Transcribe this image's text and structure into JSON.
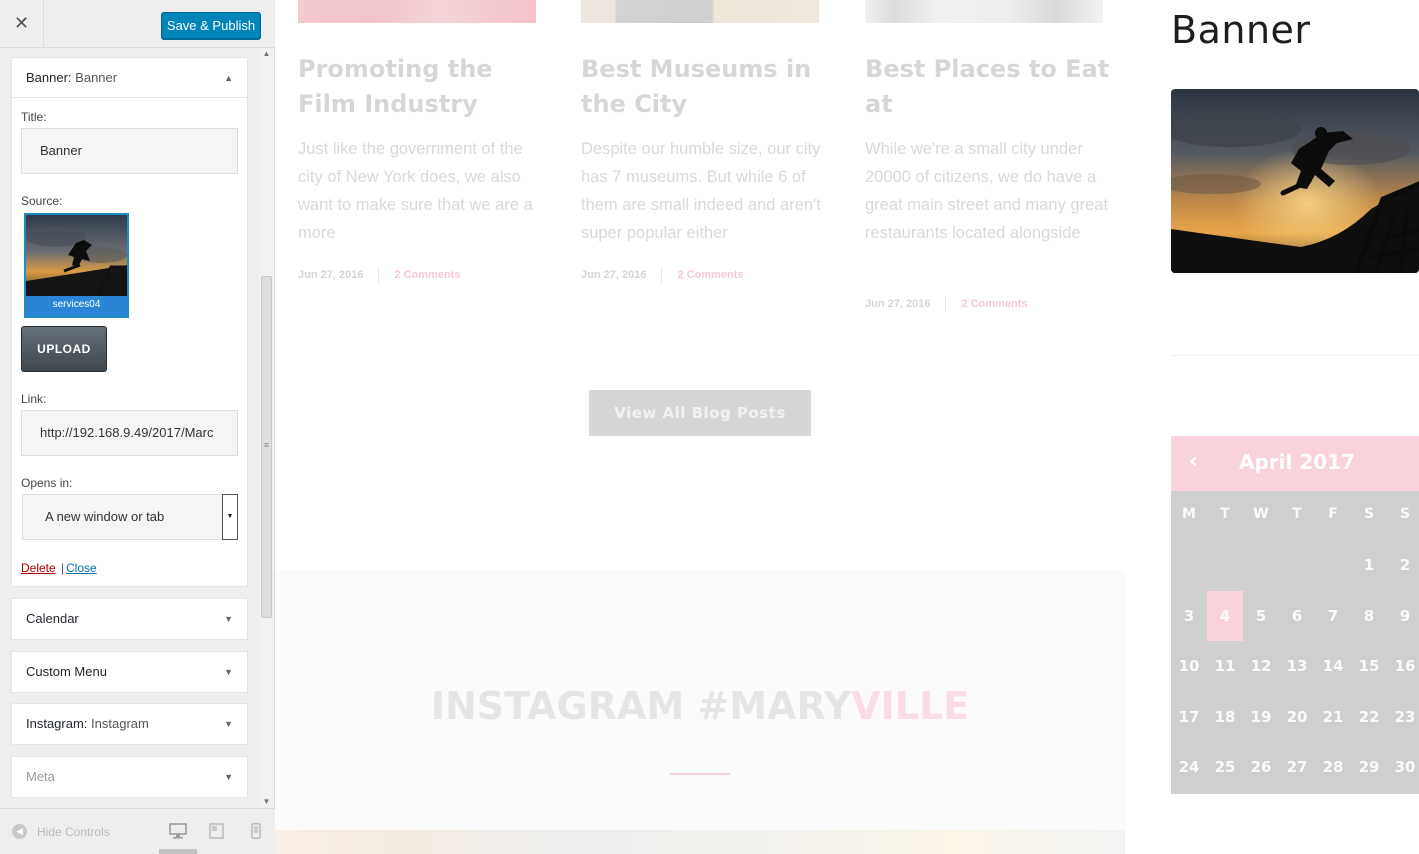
{
  "customizer": {
    "close_glyph": "✕",
    "save_label": "Save & Publish",
    "banner_widget": {
      "header_name": "Banner:",
      "header_sub": "Banner",
      "title_label": "Title:",
      "title_value": "Banner",
      "source_label": "Source:",
      "source_filename": "services04",
      "upload_label": "UPLOAD",
      "link_label": "Link:",
      "link_value": "http://192.168.9.49/2017/Marc",
      "opens_label": "Opens in:",
      "opens_value": "A new window or tab",
      "delete_label": "Delete",
      "separator": "|",
      "close_label": "Close"
    },
    "widgets": [
      {
        "name": "Calendar",
        "sub": ""
      },
      {
        "name": "Custom Menu",
        "sub": ""
      },
      {
        "name": "Instagram:",
        "sub": "Instagram"
      },
      {
        "name": "Meta",
        "sub": ""
      }
    ],
    "hide_controls_label": "Hide Controls",
    "arrow_up": "▲",
    "arrow_down": "▼"
  },
  "preview": {
    "posts": [
      {
        "title": "Promoting the Film Industry",
        "excerpt": "Just like the government of the city of New York does, we also want to make sure that we are a more",
        "date": "Jun 27, 2016",
        "comments": "2 Comments"
      },
      {
        "title": "Best Museums in the City",
        "excerpt": "Despite our humble size, our city has 7 museums. But while 6 of them are small indeed and aren't super popular either",
        "date": "Jun 27, 2016",
        "comments": "2 Comments"
      },
      {
        "title": "Best Places to Eat at",
        "excerpt": "While we're a small city under 20000 of citizens, we do have a great main street and many great restaurants located alongside",
        "date": "Jun 27, 2016",
        "comments": "2 Comments"
      }
    ],
    "view_all_label": "View All Blog Posts",
    "instagram_heading_main": "INSTAGRAM #MARY",
    "instagram_heading_accent": "VILLE",
    "banner_heading": "Banner",
    "calendar": {
      "prev_glyph": "‹",
      "month": "April 2017",
      "weekdays": [
        "M",
        "T",
        "W",
        "T",
        "F",
        "S",
        "S"
      ],
      "weeks": [
        [
          "",
          "",
          "",
          "",
          "",
          "1",
          "2"
        ],
        [
          "3",
          "4",
          "5",
          "6",
          "7",
          "8",
          "9"
        ],
        [
          "10",
          "11",
          "12",
          "13",
          "14",
          "15",
          "16"
        ],
        [
          "17",
          "18",
          "19",
          "20",
          "21",
          "22",
          "23"
        ],
        [
          "24",
          "25",
          "26",
          "27",
          "28",
          "29",
          "30"
        ]
      ],
      "today": "4"
    }
  },
  "colors": {
    "primary_button": "#0085ba",
    "accent_pink": "#f9d2dc",
    "delete_red": "#aa0000",
    "link_blue": "#0073aa"
  }
}
